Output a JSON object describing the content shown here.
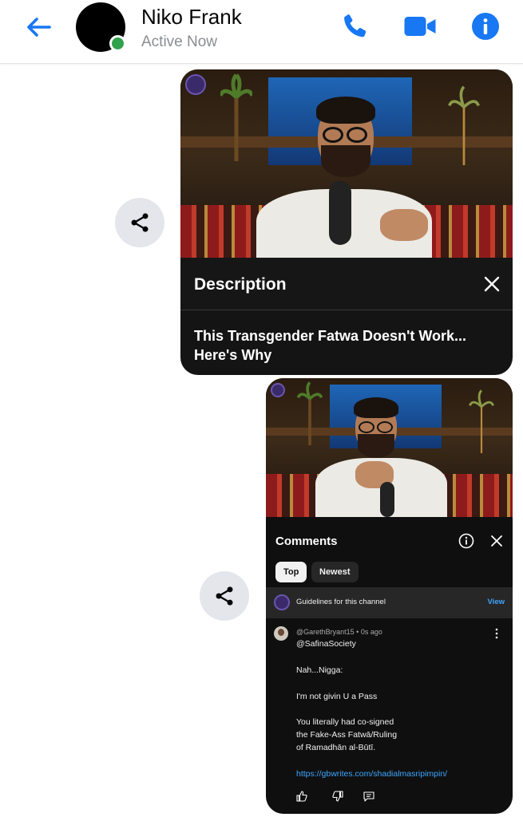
{
  "header": {
    "contact_name": "Niko Frank",
    "status": "Active Now",
    "colors": {
      "accent": "#1877f2",
      "presence": "#31a24c"
    },
    "icons": [
      "back-arrow-icon",
      "phone-icon",
      "video-camera-icon",
      "info-icon"
    ]
  },
  "message1": {
    "panel_title": "Description",
    "video_title": "This Transgender Fatwa Doesn't Work... Here's Why",
    "icons": [
      "share-icon",
      "close-icon"
    ]
  },
  "message2": {
    "panel_title": "Comments",
    "chips": {
      "top": "Top",
      "newest": "Newest"
    },
    "guidelines": {
      "text": "Guidelines for this channel",
      "link": "View"
    },
    "comment": {
      "author_meta": "@GarethBryant15 • 0s ago",
      "lines": [
        "@SafinaSociety",
        "Nah...Nigga:",
        "I'm not givin U a Pass",
        "You literally had co-signed",
        "the Fake-Ass Fatwā/Ruling",
        "of Ramadhān al-Būtī.",
        "https://gbwrites.com/shadialmasripimpin/"
      ]
    },
    "icons": [
      "share-icon",
      "info-icon",
      "close-icon",
      "more-vert-icon",
      "thumb-up-icon",
      "thumb-down-icon",
      "reply-icon"
    ]
  }
}
